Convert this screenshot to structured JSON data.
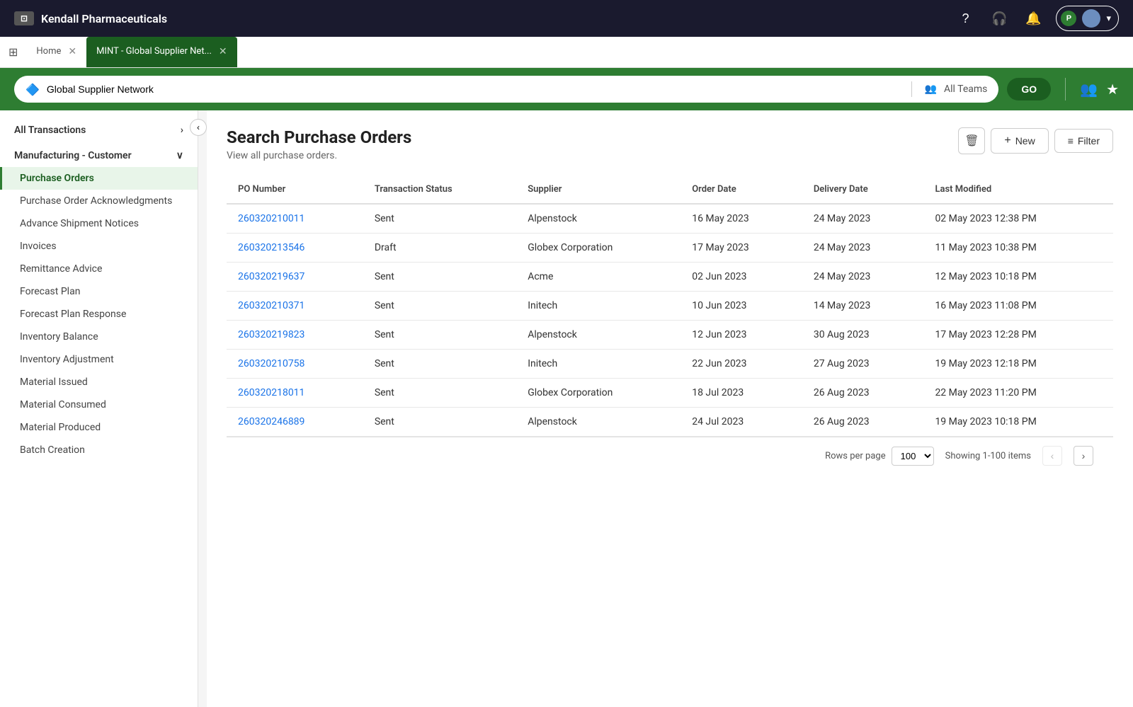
{
  "app": {
    "title": "Kendall Pharmaceuticals",
    "icon_symbol": "⊡"
  },
  "header": {
    "help_icon": "?",
    "headset_icon": "🎧",
    "bell_icon": "🔔",
    "user_initial": "P",
    "user_avatar_color": "#6c8ebf"
  },
  "tabs": [
    {
      "id": "home",
      "label": "Home",
      "active": false,
      "closable": true
    },
    {
      "id": "mint",
      "label": "MINT - Global Supplier Net...",
      "active": true,
      "closable": true
    }
  ],
  "search": {
    "workspace": "Global Supplier Network",
    "teams": "All Teams",
    "go_label": "GO",
    "teams_icon": "👥",
    "workspace_icon": "🔷"
  },
  "sidebar": {
    "collapse_icon": "‹",
    "all_transactions_label": "All Transactions",
    "manufacturing_customer_label": "Manufacturing - Customer",
    "items": [
      {
        "id": "purchase-orders",
        "label": "Purchase Orders",
        "active": true,
        "indent": true
      },
      {
        "id": "po-acknowledgments",
        "label": "Purchase Order Acknowledgments",
        "active": false,
        "indent": true
      },
      {
        "id": "advance-shipment-notices",
        "label": "Advance Shipment Notices",
        "active": false,
        "indent": true
      },
      {
        "id": "invoices",
        "label": "Invoices",
        "active": false,
        "indent": true
      },
      {
        "id": "remittance-advice",
        "label": "Remittance Advice",
        "active": false,
        "indent": true
      },
      {
        "id": "forecast-plan",
        "label": "Forecast Plan",
        "active": false,
        "indent": true
      },
      {
        "id": "forecast-plan-response",
        "label": "Forecast Plan Response",
        "active": false,
        "indent": true
      },
      {
        "id": "inventory-balance",
        "label": "Inventory Balance",
        "active": false,
        "indent": true
      },
      {
        "id": "inventory-adjustment",
        "label": "Inventory Adjustment",
        "active": false,
        "indent": true
      },
      {
        "id": "material-issued",
        "label": "Material Issued",
        "active": false,
        "indent": true
      },
      {
        "id": "material-consumed",
        "label": "Material Consumed",
        "active": false,
        "indent": true
      },
      {
        "id": "material-produced",
        "label": "Material Produced",
        "active": false,
        "indent": true
      },
      {
        "id": "batch-creation",
        "label": "Batch Creation",
        "active": false,
        "indent": true
      }
    ]
  },
  "page": {
    "title": "Search Purchase Orders",
    "subtitle": "View all purchase orders.",
    "delete_tooltip": "Delete",
    "new_label": "New",
    "filter_label": "Filter"
  },
  "table": {
    "columns": [
      {
        "id": "po-number",
        "label": "PO Number"
      },
      {
        "id": "transaction-status",
        "label": "Transaction Status"
      },
      {
        "id": "supplier",
        "label": "Supplier"
      },
      {
        "id": "order-date",
        "label": "Order Date"
      },
      {
        "id": "delivery-date",
        "label": "Delivery Date"
      },
      {
        "id": "last-modified",
        "label": "Last Modified"
      }
    ],
    "rows": [
      {
        "po_number": "260320210011",
        "status": "Sent",
        "supplier": "Alpenstock",
        "order_date": "16 May 2023",
        "delivery_date": "24 May 2023",
        "last_modified": "02 May 2023 12:38 PM"
      },
      {
        "po_number": "260320213546",
        "status": "Draft",
        "supplier": "Globex Corporation",
        "order_date": "17 May 2023",
        "delivery_date": "24 May 2023",
        "last_modified": "11 May 2023 10:38 PM"
      },
      {
        "po_number": "260320219637",
        "status": "Sent",
        "supplier": "Acme",
        "order_date": "02 Jun 2023",
        "delivery_date": "24 May 2023",
        "last_modified": "12 May 2023 10:18 PM"
      },
      {
        "po_number": "260320210371",
        "status": "Sent",
        "supplier": "Initech",
        "order_date": "10 Jun 2023",
        "delivery_date": "14 May 2023",
        "last_modified": "16 May 2023 11:08 PM"
      },
      {
        "po_number": "260320219823",
        "status": "Sent",
        "supplier": "Alpenstock",
        "order_date": "12 Jun 2023",
        "delivery_date": "30 Aug 2023",
        "last_modified": "17 May 2023 12:28 PM"
      },
      {
        "po_number": "260320210758",
        "status": "Sent",
        "supplier": "Initech",
        "order_date": "22 Jun 2023",
        "delivery_date": "27 Aug 2023",
        "last_modified": "19 May 2023 12:18 PM"
      },
      {
        "po_number": "260320218011",
        "status": "Sent",
        "supplier": "Globex Corporation",
        "order_date": "18 Jul 2023",
        "delivery_date": "26 Aug 2023",
        "last_modified": "22 May 2023 11:20 PM"
      },
      {
        "po_number": "260320246889",
        "status": "Sent",
        "supplier": "Alpenstock",
        "order_date": "24 Jul 2023",
        "delivery_date": "26 Aug 2023",
        "last_modified": "19 May 2023 10:18 PM"
      }
    ]
  },
  "pagination": {
    "rows_per_page_label": "Rows per page",
    "rows_per_page_value": "100",
    "showing_label": "Showing 1-100 items",
    "prev_icon": "‹",
    "next_icon": "›"
  }
}
